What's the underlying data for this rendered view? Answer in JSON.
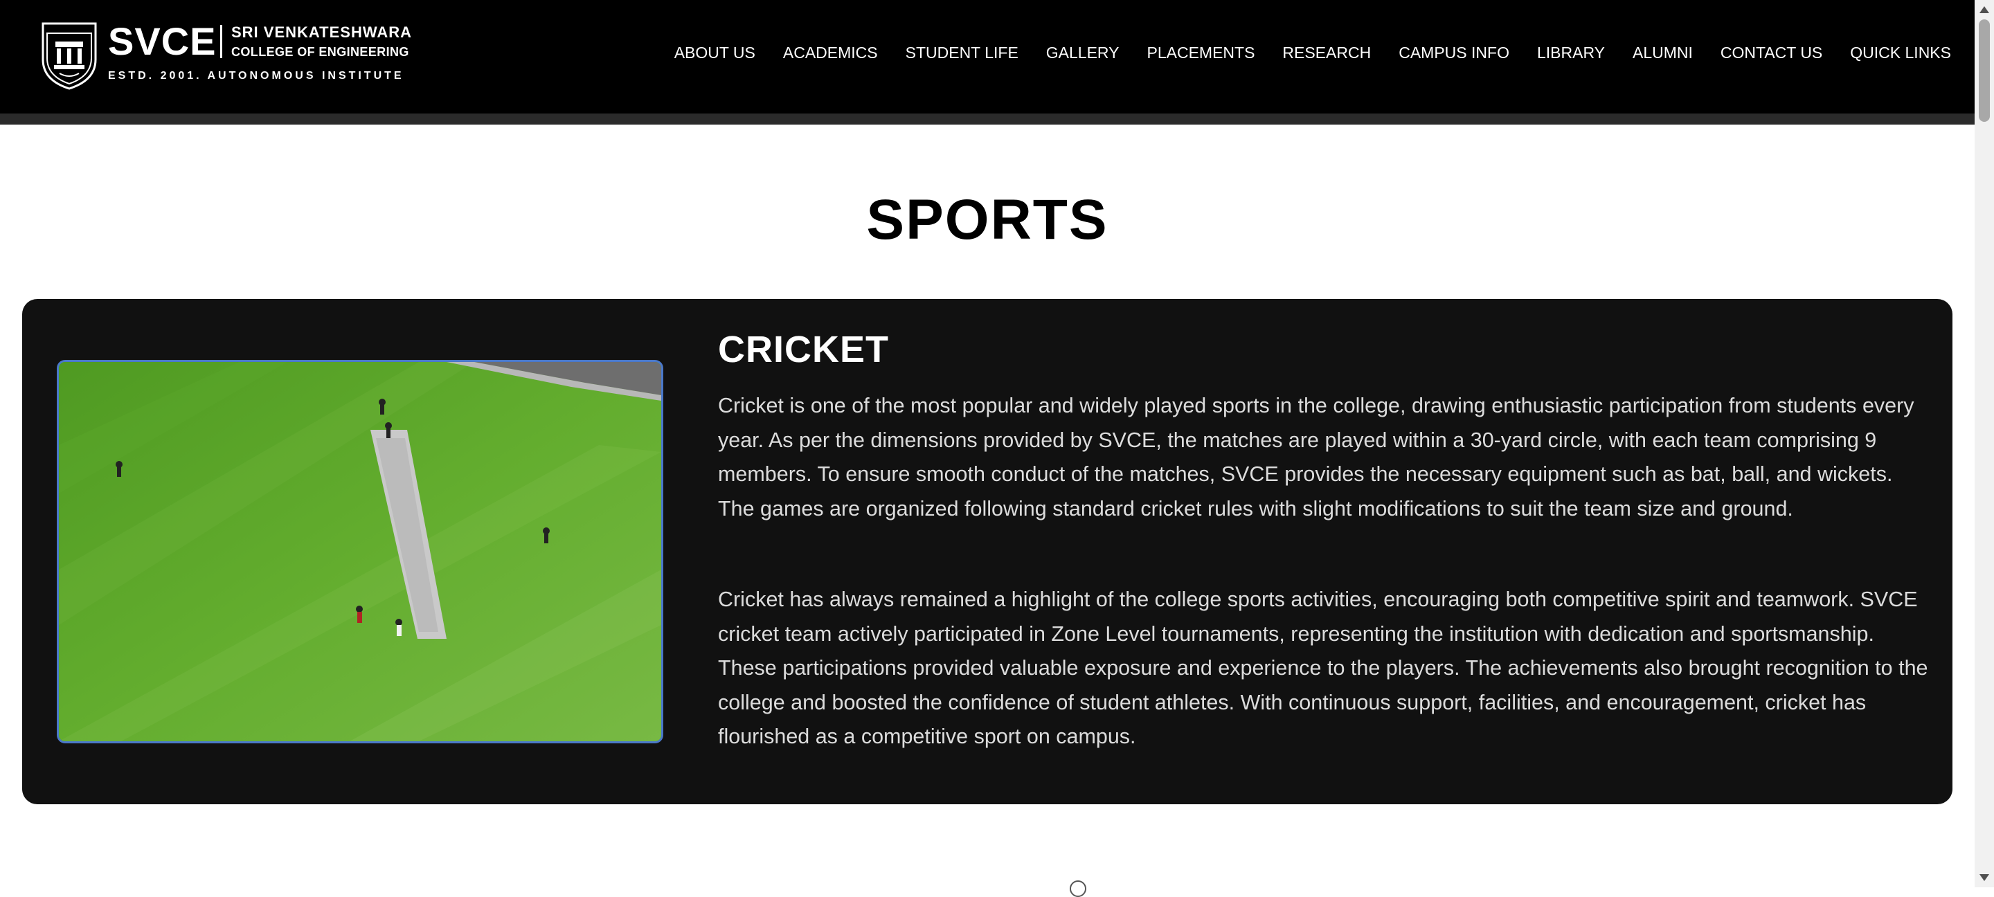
{
  "brand": {
    "crest_label": "SVCE BENGALURU",
    "name": "SVCE",
    "line1": "SRI VENKATESHWARA",
    "line2": "COLLEGE OF ENGINEERING",
    "tagline": "ESTD. 2001. AUTONOMOUS INSTITUTE"
  },
  "nav": {
    "items": [
      {
        "label": "ABOUT US"
      },
      {
        "label": "ACADEMICS"
      },
      {
        "label": "STUDENT LIFE"
      },
      {
        "label": "GALLERY"
      },
      {
        "label": "PLACEMENTS"
      },
      {
        "label": "RESEARCH"
      },
      {
        "label": "CAMPUS INFO"
      },
      {
        "label": "LIBRARY"
      },
      {
        "label": "ALUMNI"
      },
      {
        "label": "CONTACT US"
      },
      {
        "label": "QUICK LINKS"
      }
    ]
  },
  "page": {
    "title": "SPORTS"
  },
  "sport": {
    "title": "CRICKET",
    "paragraphs": [
      "Cricket is one of the most popular and widely played sports in the college, drawing enthusiastic participation from students every year. As per the dimensions provided by SVCE, the matches are played within a 30-yard circle, with each team comprising 9 members. To ensure smooth conduct of the matches, SVCE provides the necessary equipment such as bat, ball, and wickets. The games are organized following standard cricket rules with slight modifications to suit the team size and ground.",
      "Cricket has always remained a highlight of the college sports activities, encouraging both competitive spirit and teamwork. SVCE cricket team actively participated in Zone Level tournaments, representing the institution with dedication and sportsmanship. These participations provided valuable exposure and experience to the players. The achievements also brought recognition to the college and boosted the confidence of student athletes. With continuous support, facilities, and encouragement, cricket has flourished as a competitive sport on campus."
    ]
  },
  "colors": {
    "header_bg": "#000000",
    "card_bg": "#111111",
    "photo_border": "#4a78c9",
    "field_green": "#5fa62c"
  }
}
